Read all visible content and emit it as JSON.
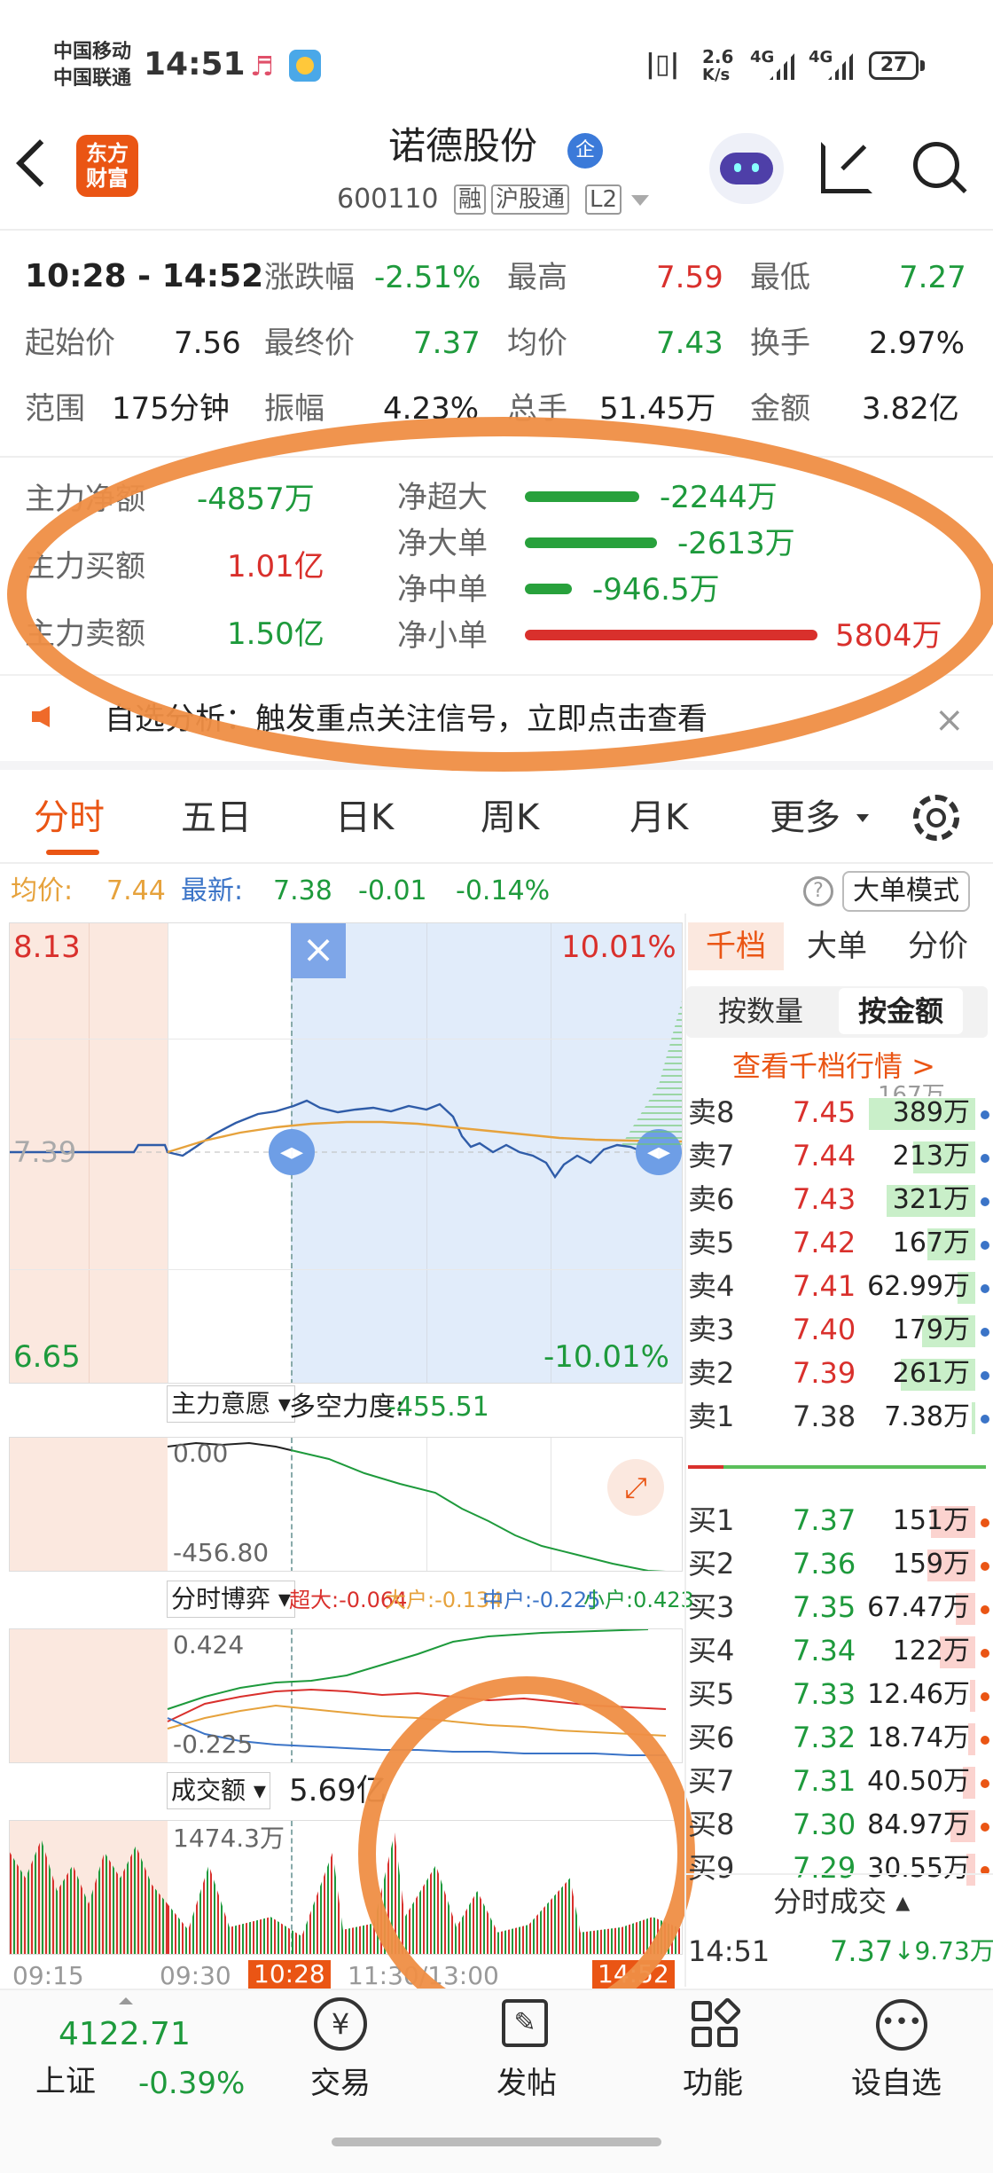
{
  "status": {
    "carrier1": "中国移动",
    "carrier2": "中国联通",
    "time": "14:51",
    "speed_top": "2.6",
    "speed_bot": "K/s",
    "net1": "4G",
    "net2": "4G",
    "battery": "27"
  },
  "header": {
    "logo_line1": "东方",
    "logo_line2": "财富",
    "name": "诺德股份",
    "badge": "企",
    "code": "600110",
    "tag1": "融",
    "tag2": "沪股通",
    "tag3": "L2"
  },
  "range": {
    "time": "10:28 - 14:52",
    "r1": [
      [
        "涨跌幅",
        "-2.51%"
      ],
      [
        "最高",
        "7.59"
      ],
      [
        "最低",
        "7.27"
      ]
    ],
    "r2": [
      [
        "起始价",
        "7.56"
      ],
      [
        "最终价",
        "7.37"
      ],
      [
        "均价",
        "7.43"
      ],
      [
        "换手",
        "2.97%"
      ]
    ],
    "r3": [
      [
        "范围",
        "175分钟"
      ],
      [
        "振幅",
        "4.23%"
      ],
      [
        "总手",
        "51.45万"
      ],
      [
        "金额",
        "3.82亿"
      ]
    ]
  },
  "flow": {
    "left": [
      [
        "主力净额",
        "-4857万"
      ],
      [
        "主力买额",
        "1.01亿"
      ],
      [
        "主力卖额",
        "1.50亿"
      ]
    ],
    "right": [
      {
        "label": "净超大",
        "value": "-2244万",
        "ratio": 0.39
      },
      {
        "label": "净大单",
        "value": "-2613万",
        "ratio": 0.45
      },
      {
        "label": "净中单",
        "value": "-946.5万",
        "ratio": 0.16
      },
      {
        "label": "净小单",
        "value": "5804万",
        "ratio": 1.0
      }
    ]
  },
  "notice": {
    "text": "自选分析：触发重点关注信号，立即点击查看"
  },
  "tabs": [
    "分时",
    "五日",
    "日K",
    "周K",
    "月K",
    "更多"
  ],
  "infobar": {
    "avg_label": "均价:",
    "avg": "7.44",
    "last_label": "最新:",
    "last": "7.38",
    "chg": "-0.01",
    "pct": "-0.14%",
    "mode": "大单模式"
  },
  "chart": {
    "top": "8.13",
    "bottom": "6.65",
    "mid": "7.39",
    "top_pct": "10.01%",
    "bottom_pct": "-10.01%",
    "close_x": "×"
  },
  "ind1": {
    "name": "主力意愿",
    "label": "多空力度:",
    "value": "-455.51",
    "top": "0.00",
    "bottom": "-456.80"
  },
  "ind2": {
    "name": "分时博弈",
    "cd": "超大:-0.064",
    "dd": "大户:-0.134",
    "zh": "中户:-0.225",
    "xh": "小户:0.423",
    "top": "0.424",
    "bottom": "-0.225"
  },
  "ind3": {
    "name": "成交额",
    "total": "5.69亿",
    "max": "1474.3万"
  },
  "timeaxis": {
    "t1": "09:15",
    "t2": "09:30",
    "t3": "10:28",
    "t4": "11:30/13:00",
    "t5": "14:52"
  },
  "depth": {
    "tabs": [
      "千档",
      "大单",
      "分价"
    ],
    "sub": [
      "按数量",
      "按金额"
    ],
    "link": "查看千档行情 >",
    "partial": "167万",
    "sell": [
      [
        "卖8",
        "7.45",
        "389万",
        0.6
      ],
      [
        "卖7",
        "7.44",
        "213万",
        0.35
      ],
      [
        "卖6",
        "7.43",
        "321万",
        0.5
      ],
      [
        "卖5",
        "7.42",
        "167万",
        0.27
      ],
      [
        "卖4",
        "7.41",
        "62.99万",
        0.1
      ],
      [
        "卖3",
        "7.40",
        "179万",
        0.3
      ],
      [
        "卖2",
        "7.39",
        "261万",
        0.42
      ],
      [
        "卖1",
        "7.38",
        "7.38万",
        0.02
      ]
    ],
    "buy": [
      [
        "买1",
        "7.37",
        "151万",
        0.25
      ],
      [
        "买2",
        "7.36",
        "159万",
        0.27
      ],
      [
        "买3",
        "7.35",
        "67.47万",
        0.11
      ],
      [
        "买4",
        "7.34",
        "122万",
        0.2
      ],
      [
        "买5",
        "7.33",
        "12.46万",
        0.03
      ],
      [
        "买6",
        "7.32",
        "18.74万",
        0.04
      ],
      [
        "买7",
        "7.31",
        "40.50万",
        0.07
      ],
      [
        "买8",
        "7.30",
        "84.97万",
        0.14
      ],
      [
        "买9",
        "7.29",
        "30.55万",
        0.05
      ]
    ],
    "tick_title": "分时成交",
    "tick": {
      "time": "14:51",
      "price": "7.37",
      "vol": "↓9.73万"
    }
  },
  "bottom": {
    "index_value": "4122.71",
    "index_name": "上证",
    "index_pct": "-0.39%",
    "items": [
      "交易",
      "发帖",
      "功能",
      "设自选"
    ]
  }
}
